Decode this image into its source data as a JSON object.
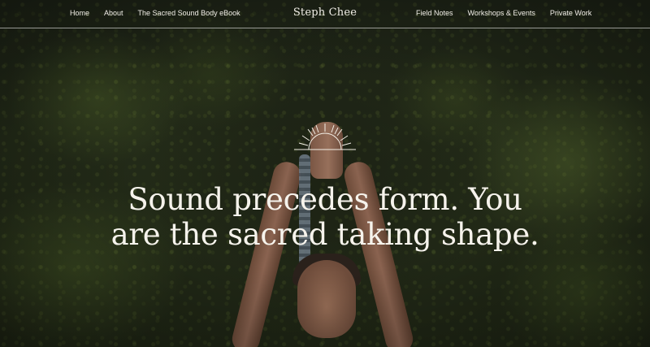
{
  "nav": {
    "left": [
      {
        "label": "Home"
      },
      {
        "label": "About"
      },
      {
        "label": "The Sacred Sound Body eBook"
      }
    ],
    "brand": "Steph Chee",
    "right": [
      {
        "label": "Field Notes"
      },
      {
        "label": "Workshops & Events"
      },
      {
        "label": "Private Work"
      }
    ]
  },
  "hero": {
    "logo_icon": "sun-rays-icon",
    "headline_line1": "Sound precedes form. You",
    "headline_line2": "are the sacred taking shape."
  },
  "colors": {
    "text": "#f6f3ec",
    "background": "#1f2615"
  }
}
